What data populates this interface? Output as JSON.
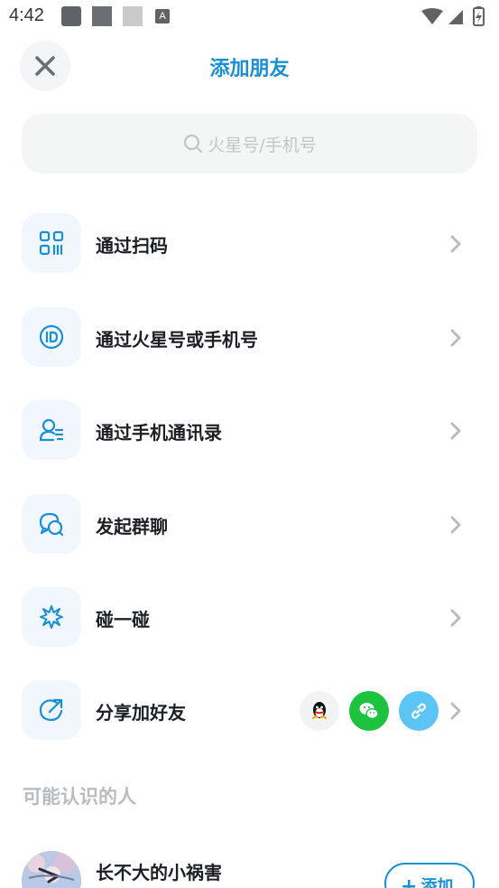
{
  "status_bar": {
    "time": "4:42"
  },
  "header": {
    "title": "添加朋友",
    "close_icon": "close-icon"
  },
  "search": {
    "placeholder": "火星号/手机号",
    "icon": "search-icon"
  },
  "menu": {
    "items": [
      {
        "label": "通过扫码",
        "icon": "qr-code-icon"
      },
      {
        "label": "通过火星号或手机号",
        "icon": "id-icon"
      },
      {
        "label": "通过手机通讯录",
        "icon": "contacts-icon"
      },
      {
        "label": "发起群聊",
        "icon": "group-chat-icon"
      },
      {
        "label": "碰一碰",
        "icon": "bump-icon"
      },
      {
        "label": "分享加好友",
        "icon": "share-icon"
      }
    ],
    "share_targets": [
      {
        "name": "qq",
        "icon": "qq-icon",
        "color": "#f1f3f4"
      },
      {
        "name": "wechat",
        "icon": "wechat-icon",
        "color": "#1dc23f"
      },
      {
        "name": "link",
        "icon": "link-icon",
        "color": "#5cc5f5"
      }
    ]
  },
  "suggestions": {
    "section_title": "可能认识的人",
    "people": [
      {
        "name": "长不大的小祸害",
        "action_label": "添加"
      }
    ]
  },
  "colors": {
    "accent": "#1a8fd6",
    "icon_bg": "#f1f7fd",
    "search_bg": "#f4f6f6",
    "muted_text": "#b7bcc1"
  }
}
